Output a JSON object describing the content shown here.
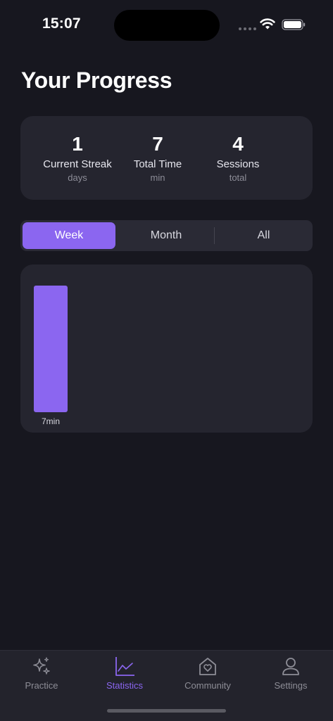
{
  "status_bar": {
    "time": "15:07"
  },
  "page": {
    "title": "Your Progress"
  },
  "stats": [
    {
      "value": "1",
      "label": "Current Streak",
      "unit": "days"
    },
    {
      "value": "7",
      "label": "Total Time",
      "unit": "min"
    },
    {
      "value": "4",
      "label": "Sessions",
      "unit": "total"
    }
  ],
  "segments": {
    "options": [
      "Week",
      "Month",
      "All"
    ],
    "selected": "Week"
  },
  "chart_data": {
    "type": "bar",
    "categories": [
      ""
    ],
    "values": [
      7
    ],
    "data_labels": [
      "7min"
    ],
    "unit": "min",
    "color": "#8b66f0"
  },
  "tab_bar": {
    "items": [
      {
        "label": "Practice",
        "icon": "sparkles-icon"
      },
      {
        "label": "Statistics",
        "icon": "chart-icon"
      },
      {
        "label": "Community",
        "icon": "house-heart-icon"
      },
      {
        "label": "Settings",
        "icon": "person-icon"
      }
    ],
    "active": "Statistics"
  },
  "colors": {
    "background": "#17171f",
    "card": "#25252f",
    "accent": "#8b66f0",
    "muted_text": "#8d8d96"
  }
}
